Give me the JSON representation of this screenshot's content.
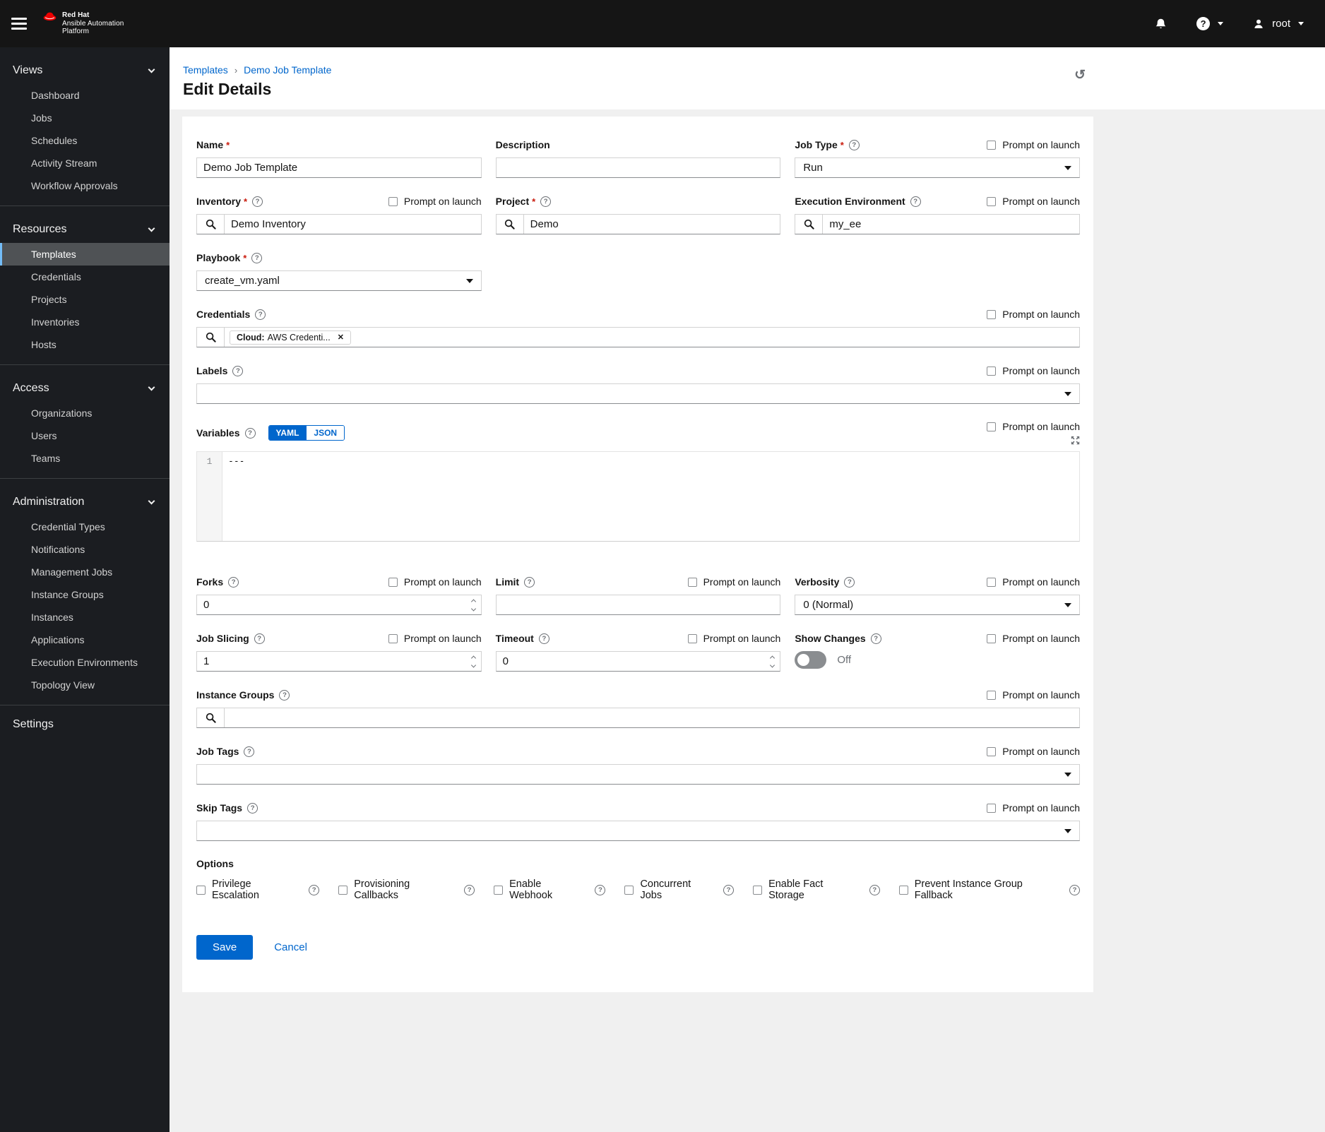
{
  "header": {
    "brand_line1": "Red Hat",
    "brand_line2": "Ansible Automation",
    "brand_line3": "Platform",
    "username": "root"
  },
  "icons": {
    "question": "?",
    "history": "↺",
    "breadcrumb_separator": "›",
    "chip_remove": "✕"
  },
  "sidebar": {
    "sections": [
      {
        "title": "Views",
        "items": [
          {
            "label": "Dashboard"
          },
          {
            "label": "Jobs"
          },
          {
            "label": "Schedules"
          },
          {
            "label": "Activity Stream"
          },
          {
            "label": "Workflow Approvals"
          }
        ]
      },
      {
        "title": "Resources",
        "items": [
          {
            "label": "Templates",
            "active": true
          },
          {
            "label": "Credentials"
          },
          {
            "label": "Projects"
          },
          {
            "label": "Inventories"
          },
          {
            "label": "Hosts"
          }
        ]
      },
      {
        "title": "Access",
        "items": [
          {
            "label": "Organizations"
          },
          {
            "label": "Users"
          },
          {
            "label": "Teams"
          }
        ]
      },
      {
        "title": "Administration",
        "items": [
          {
            "label": "Credential Types"
          },
          {
            "label": "Notifications"
          },
          {
            "label": "Management Jobs"
          },
          {
            "label": "Instance Groups"
          },
          {
            "label": "Instances"
          },
          {
            "label": "Applications"
          },
          {
            "label": "Execution Environments"
          },
          {
            "label": "Topology View"
          }
        ]
      }
    ],
    "settings": "Settings"
  },
  "breadcrumb": {
    "parent": "Templates",
    "current": "Demo Job Template"
  },
  "page": {
    "title": "Edit Details"
  },
  "labels": {
    "prompt_on_launch": "Prompt on launch",
    "required_marker": "*"
  },
  "form": {
    "name": {
      "label": "Name",
      "value": "Demo Job Template"
    },
    "description": {
      "label": "Description",
      "value": ""
    },
    "job_type": {
      "label": "Job Type",
      "value": "Run"
    },
    "inventory": {
      "label": "Inventory",
      "value": "Demo Inventory"
    },
    "project": {
      "label": "Project",
      "value": "Demo"
    },
    "execution_environment": {
      "label": "Execution Environment",
      "value": "my_ee"
    },
    "playbook": {
      "label": "Playbook",
      "value": "create_vm.yaml"
    },
    "credentials": {
      "label": "Credentials",
      "chip_category": "Cloud:",
      "chip_value": "AWS Credenti..."
    },
    "labels_field": {
      "label": "Labels",
      "value": ""
    },
    "variables": {
      "label": "Variables",
      "yaml_label": "YAML",
      "json_label": "JSON",
      "line_number": "1",
      "content": "---"
    },
    "forks": {
      "label": "Forks",
      "value": "0"
    },
    "limit": {
      "label": "Limit",
      "value": ""
    },
    "verbosity": {
      "label": "Verbosity",
      "value": "0 (Normal)"
    },
    "job_slicing": {
      "label": "Job Slicing",
      "value": "1"
    },
    "timeout": {
      "label": "Timeout",
      "value": "0"
    },
    "show_changes": {
      "label": "Show Changes",
      "state": "Off"
    },
    "instance_groups": {
      "label": "Instance Groups",
      "value": ""
    },
    "job_tags": {
      "label": "Job Tags",
      "value": ""
    },
    "skip_tags": {
      "label": "Skip Tags",
      "value": ""
    },
    "options": {
      "label": "Options",
      "items": [
        {
          "label": "Privilege Escalation"
        },
        {
          "label": "Provisioning Callbacks"
        },
        {
          "label": "Enable Webhook"
        },
        {
          "label": "Concurrent Jobs"
        },
        {
          "label": "Enable Fact Storage"
        },
        {
          "label": "Prevent Instance Group Fallback"
        }
      ]
    },
    "save_label": "Save",
    "cancel_label": "Cancel"
  },
  "colors": {
    "accent": "#0066cc",
    "brand_red": "#ee0000",
    "masthead_bg": "#151515",
    "sidebar_bg": "#1b1d21",
    "active_nav_indicator": "#73bcf7",
    "required_red": "#c9190b",
    "page_bg": "#f0f0f0"
  }
}
